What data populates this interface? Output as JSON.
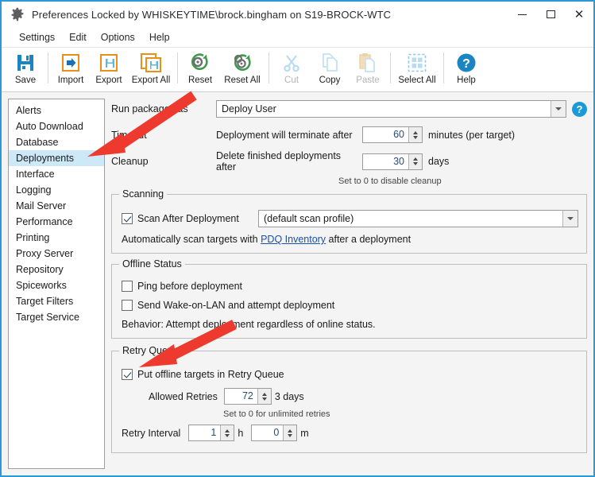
{
  "window": {
    "title": "Preferences Locked by WHISKEYTIME\\brock.bingham on S19-BROCK-WTC",
    "icon": "gear-icon",
    "accent_color": "#2b9ad4",
    "controls": {
      "minimize": "–",
      "maximize": "☐",
      "close": "✕"
    }
  },
  "menubar": {
    "items": [
      "Settings",
      "Edit",
      "Options",
      "Help"
    ]
  },
  "toolbar": {
    "buttons": [
      {
        "label": "Save",
        "icon": "save-icon",
        "enabled": true
      },
      {
        "label": "Import",
        "icon": "import-icon",
        "enabled": true
      },
      {
        "label": "Export",
        "icon": "export-icon",
        "enabled": true
      },
      {
        "label": "Export All",
        "icon": "export-all-icon",
        "enabled": true
      },
      {
        "label": "Reset",
        "icon": "reset-icon",
        "enabled": true
      },
      {
        "label": "Reset All",
        "icon": "reset-all-icon",
        "enabled": true
      },
      {
        "label": "Cut",
        "icon": "scissors-icon",
        "enabled": false
      },
      {
        "label": "Copy",
        "icon": "copy-icon",
        "enabled": false
      },
      {
        "label": "Paste",
        "icon": "paste-icon",
        "enabled": false
      },
      {
        "label": "Select All",
        "icon": "select-all-icon",
        "enabled": false
      },
      {
        "label": "Help",
        "icon": "help-icon",
        "enabled": true
      }
    ]
  },
  "sidebar": {
    "items": [
      {
        "label": "Alerts",
        "selected": false
      },
      {
        "label": "Auto Download",
        "selected": false
      },
      {
        "label": "Database",
        "selected": false
      },
      {
        "label": "Deployments",
        "selected": true
      },
      {
        "label": "Interface",
        "selected": false
      },
      {
        "label": "Logging",
        "selected": false
      },
      {
        "label": "Mail Server",
        "selected": false
      },
      {
        "label": "Performance",
        "selected": false
      },
      {
        "label": "Printing",
        "selected": false
      },
      {
        "label": "Proxy Server",
        "selected": false
      },
      {
        "label": "Repository",
        "selected": false
      },
      {
        "label": "Spiceworks",
        "selected": false
      },
      {
        "label": "Target Filters",
        "selected": false
      },
      {
        "label": "Target Service",
        "selected": false
      }
    ]
  },
  "main": {
    "run_as": {
      "label": "Run packages as",
      "value": "Deploy User",
      "help_glyph": "?"
    },
    "timeout": {
      "label": "Timeout",
      "text": "Deployment will terminate after",
      "value": "60",
      "unit": "minutes (per target)"
    },
    "cleanup": {
      "label": "Cleanup",
      "text": "Delete finished deployments after",
      "value": "30",
      "unit": "days",
      "hint": "Set to 0 to disable cleanup"
    },
    "scanning": {
      "title": "Scanning",
      "checkbox_label": "Scan After Deployment",
      "checked": true,
      "profile_value": "(default scan profile)",
      "note_before": "Automatically scan targets with ",
      "note_link": "PDQ Inventory",
      "note_after": " after a deployment"
    },
    "offline_status": {
      "title": "Offline Status",
      "ping_label": "Ping before deployment",
      "ping_checked": false,
      "wol_label": "Send Wake-on-LAN and attempt deployment",
      "wol_checked": false,
      "behavior": "Behavior: Attempt deployment regardless of online status."
    },
    "retry_queue": {
      "title": "Retry Queue",
      "enable_label": "Put offline targets in Retry Queue",
      "enable_checked": true,
      "allowed_retries_label": "Allowed Retries",
      "allowed_retries_value": "72",
      "allowed_retries_suffix": "3 days",
      "unlimited_hint": "Set to 0 for unlimited retries",
      "retry_interval_label": "Retry Interval",
      "hours_value": "1",
      "hours_unit": "h",
      "minutes_value": "0",
      "minutes_unit": "m"
    }
  },
  "annotations": {
    "arrow_color": "#ee3a2e",
    "arrows": [
      {
        "name": "arrow-to-deployments",
        "points_to": "Deployments"
      },
      {
        "name": "arrow-to-retry-queue-checkbox",
        "points_to": "Put offline targets in Retry Queue"
      }
    ]
  }
}
